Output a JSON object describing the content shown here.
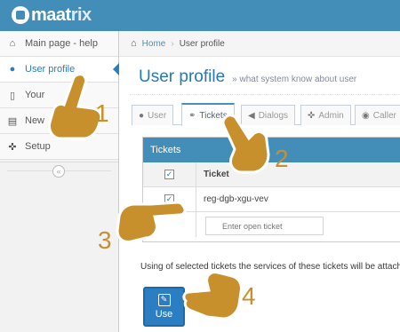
{
  "app": {
    "logo_main": "maat",
    "logo_tail": "rix"
  },
  "sidebar": {
    "items": [
      {
        "label": "Main page - help",
        "icon": "home-icon"
      },
      {
        "label": "User profile",
        "icon": "user-icon"
      },
      {
        "label": "Your",
        "icon": "phone-icon"
      },
      {
        "label": "New",
        "icon": "cart-icon"
      },
      {
        "label": "Setup",
        "icon": "wrench-icon"
      }
    ],
    "collapse_glyph": "«"
  },
  "breadcrumb": {
    "home": "Home",
    "current": "User profile"
  },
  "header": {
    "title": "User profile",
    "subtitle": "» what system know about user"
  },
  "tabs": [
    {
      "label": "User",
      "icon": "user-icon"
    },
    {
      "label": "Tickets",
      "icon": "key-icon"
    },
    {
      "label": "Dialogs",
      "icon": "megaphone-icon"
    },
    {
      "label": "Admin",
      "icon": "wrench-icon"
    },
    {
      "label": "Caller",
      "icon": "comment-icon"
    }
  ],
  "tickets": {
    "panel_title": "Tickets",
    "column_ticket": "Ticket",
    "rows": [
      {
        "ticket": "reg-dgb-xgu-vev",
        "checked": true
      }
    ],
    "input_placeholder": "Enter open ticket"
  },
  "note": "Using of selected tickets the services of these tickets will be attach",
  "use_button": {
    "label": "Use"
  },
  "annotations": {
    "n1": "1",
    "n2": "2",
    "n3": "3",
    "n4": "4"
  },
  "colors": {
    "brand": "#438eb9",
    "accent": "#2679b5",
    "hand": "#c8902c"
  }
}
